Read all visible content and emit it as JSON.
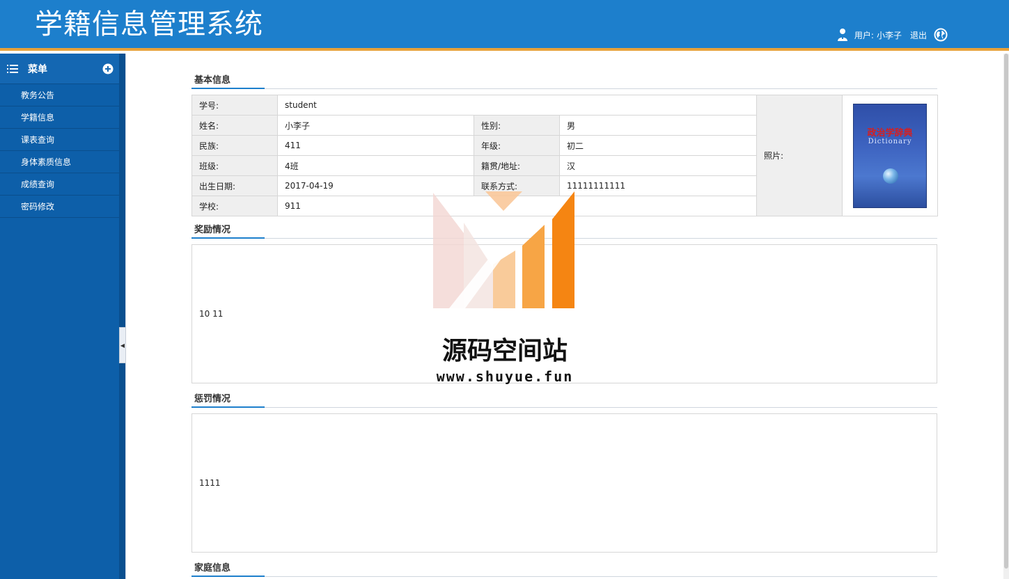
{
  "header": {
    "title": "学籍信息管理系统",
    "user_label": "用户:",
    "username": "小李子",
    "logout": "退出"
  },
  "sidebar": {
    "title": "菜单",
    "items": [
      {
        "label": "教务公告"
      },
      {
        "label": "学籍信息"
      },
      {
        "label": "课表查询"
      },
      {
        "label": "身体素质信息"
      },
      {
        "label": "成绩查询"
      },
      {
        "label": "密码修改"
      }
    ]
  },
  "basic": {
    "section_title": "基本信息",
    "student_no_label": "学号:",
    "student_no": "student",
    "name_label": "姓名:",
    "name": "小李子",
    "gender_label": "性别:",
    "gender": "男",
    "ethnicity_label": "民族:",
    "ethnicity": "411",
    "grade_label": "年级:",
    "grade": "初二",
    "class_label": "班级:",
    "class": "4班",
    "origin_label": "籍贯/地址:",
    "origin": "汉",
    "birth_label": "出生日期:",
    "birth": "2017-04-19",
    "contact_label": "联系方式:",
    "contact": "11111111111",
    "school_label": "学校:",
    "school": "911",
    "photo_label": "照片:",
    "photo_title": "政治学辞典",
    "photo_subtitle": "Dictionary"
  },
  "rewards": {
    "section_title": "奖励情况",
    "content": "10 11"
  },
  "punishments": {
    "section_title": "惩罚情况",
    "content": "1111"
  },
  "family": {
    "section_title": "家庭信息"
  },
  "watermark": {
    "text": "源码空间站",
    "url": "www.shuyue.fun"
  },
  "colors": {
    "header_bg": "#1d7fcc",
    "header_border": "#e8a23a",
    "sidebar_bg": "#0d5fa9",
    "accent": "#1d7fcc"
  }
}
